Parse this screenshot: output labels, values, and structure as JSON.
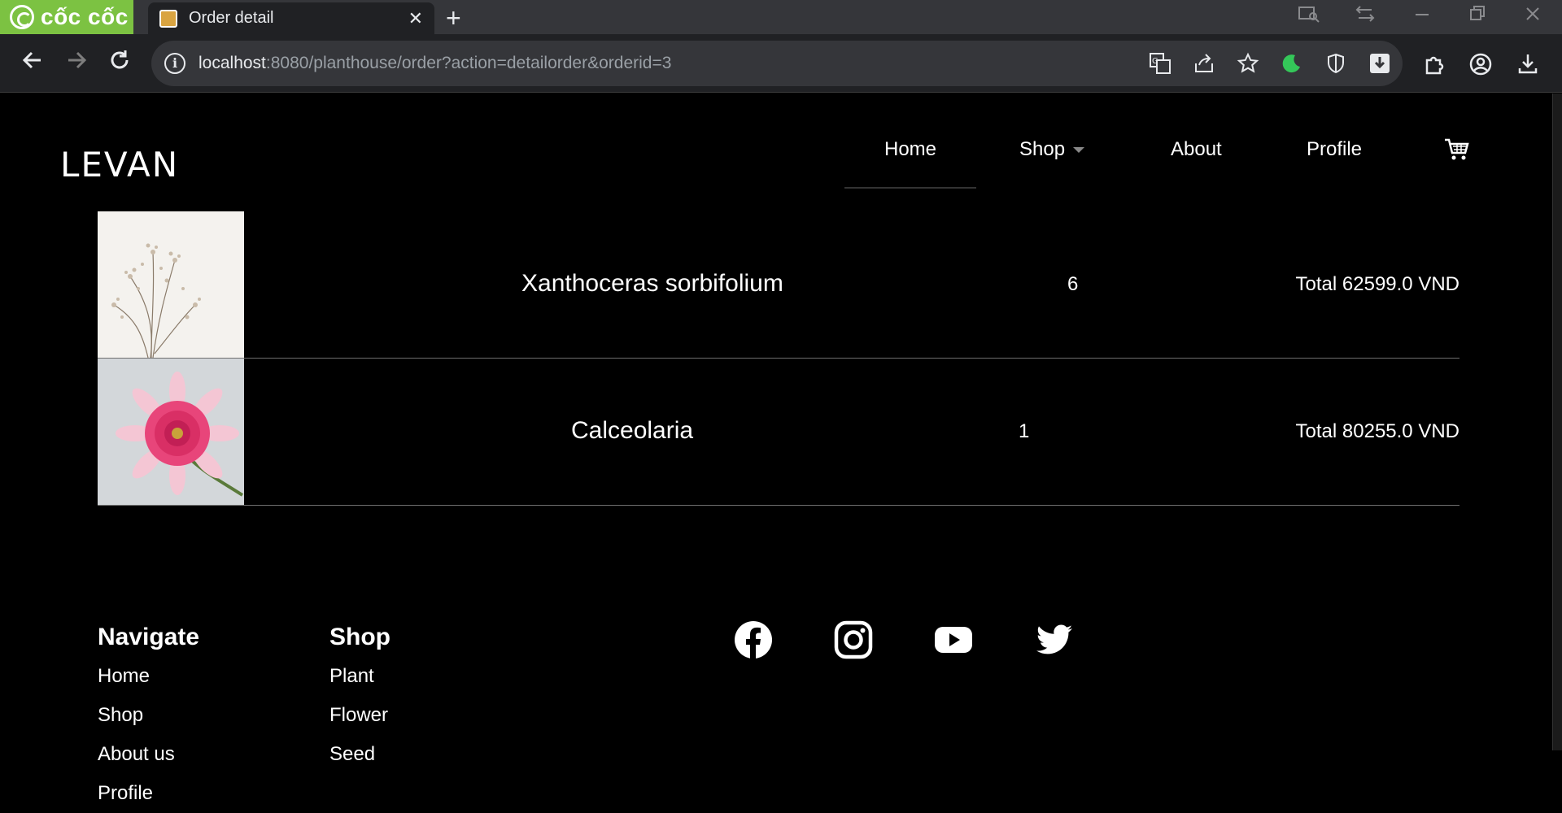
{
  "browser": {
    "brand": "cốc cốc",
    "tab_title": "Order detail",
    "tab_close": "✕",
    "new_tab": "+",
    "url_host": "localhost",
    "url_rest": ":8080/planthouse/order?action=detailorder&orderid=3"
  },
  "site": {
    "logo": "LEVAN",
    "nav": {
      "home": "Home",
      "shop": "Shop",
      "about": "About",
      "profile": "Profile"
    }
  },
  "order": {
    "items": [
      {
        "name": "Xanthoceras sorbifolium",
        "qty": "6",
        "total": "Total 62599.0 VND",
        "image": "dried-flower-photo"
      },
      {
        "name": "Calceolaria",
        "qty": "1",
        "total": "Total 80255.0 VND",
        "image": "pink-dahlia-photo"
      }
    ]
  },
  "footer": {
    "navigate": {
      "heading": "Navigate",
      "links": [
        "Home",
        "Shop",
        "About us",
        "Profile"
      ]
    },
    "shop": {
      "heading": "Shop",
      "links": [
        "Plant",
        "Flower",
        "Seed"
      ]
    },
    "social_icons": [
      "facebook-icon",
      "instagram-icon",
      "youtube-icon",
      "twitter-icon"
    ]
  }
}
